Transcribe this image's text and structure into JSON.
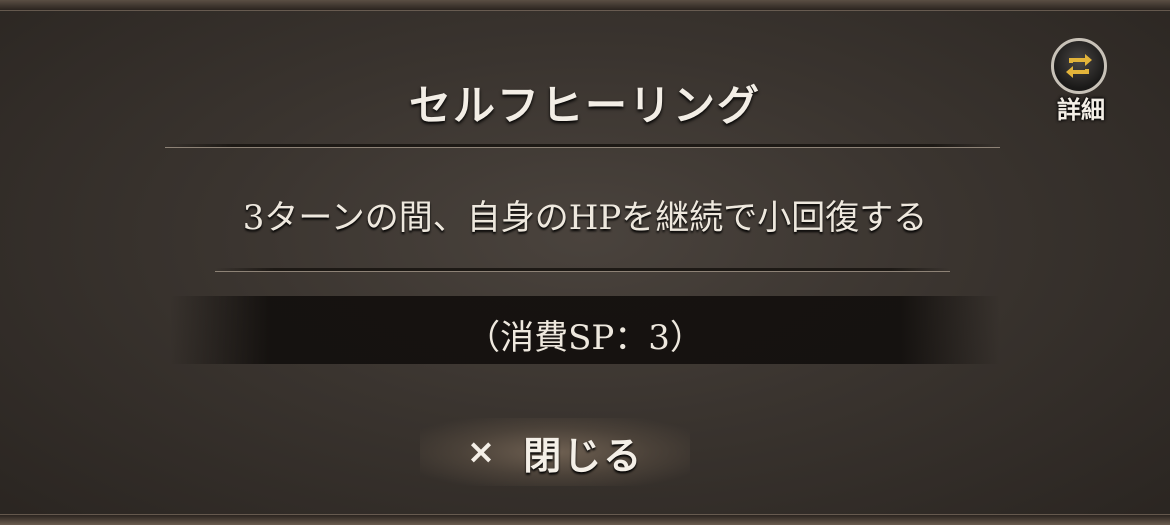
{
  "dialog": {
    "title": "セルフヒーリング",
    "description": "3ターンの間、自身のHPを継続で小回復する",
    "cost": "（消費SP：3）",
    "close_icon": "×",
    "close_label": "閉じる"
  },
  "detail_button": {
    "label": "詳細",
    "icon": "swap-arrows-icon"
  },
  "colors": {
    "accent_gold": "#e3b43a",
    "text": "#ece6dc"
  }
}
